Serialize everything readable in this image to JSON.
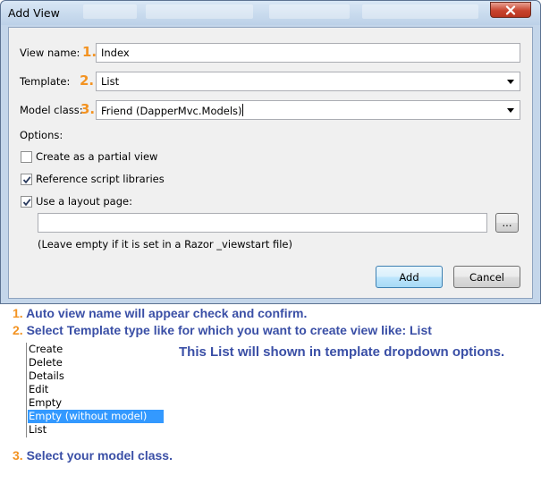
{
  "dialog": {
    "title": "Add View",
    "close_icon": "close-x-icon",
    "view_name_label": "View name:",
    "view_name_value": "Index",
    "template_label": "Template:",
    "template_value": "List",
    "model_class_label": "Model class:",
    "model_class_value": "Friend (DapperMvc.Models)",
    "options_label": "Options:",
    "partial_view_label": "Create as a partial view",
    "partial_view_checked": false,
    "script_libraries_label": "Reference script libraries",
    "script_libraries_checked": true,
    "layout_page_label": "Use a layout page:",
    "layout_page_checked": true,
    "layout_page_value": "",
    "browse_label": "...",
    "layout_hint": "(Leave empty if it is set in a Razor _viewstart file)",
    "add_label": "Add",
    "cancel_label": "Cancel"
  },
  "markers": {
    "one": "1.",
    "two": "2.",
    "three": "3."
  },
  "instructions": {
    "step1_num": "1.",
    "step1_text": "Auto view name will appear check and confirm.",
    "step2_num": "2.",
    "step2_text": "Select Template type like for which you want to create view like: List",
    "list_note": "This List will shown in template dropdown options.",
    "step3_num": "3.",
    "step3_text": "Select your model class."
  },
  "template_options": [
    "Create",
    "Delete",
    "Details",
    "Edit",
    "Empty",
    "Empty (without model)",
    "List"
  ],
  "template_options_selected": "Empty (without model)",
  "colors": {
    "accent_orange": "#f39322",
    "instruction_blue": "#3a4fa6",
    "selection_blue": "#3399ff"
  }
}
